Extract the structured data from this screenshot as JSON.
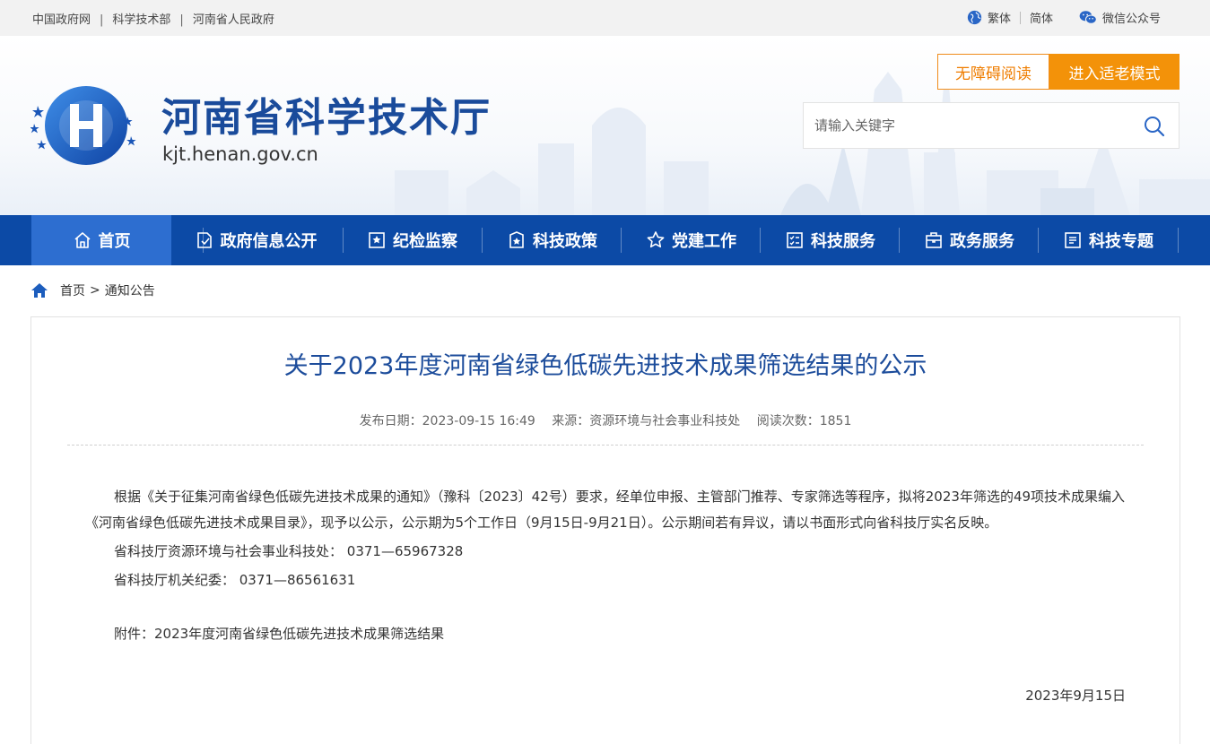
{
  "topbar": {
    "links": [
      "中国政府网",
      "科学技术部",
      "河南省人民政府"
    ],
    "separator": "|",
    "traditional": "繁体",
    "simplified": "简体",
    "wechat": "微信公众号"
  },
  "header": {
    "site_title": "河南省科学技术厅",
    "domain": "kjt.henan.gov.cn",
    "accessibility_label": "无障碍阅读",
    "elder_mode_label": "进入适老模式",
    "search_placeholder": "请输入关键字"
  },
  "nav": {
    "items": [
      {
        "label": "首页",
        "icon": "home-icon"
      },
      {
        "label": "政府信息公开",
        "icon": "document-icon"
      },
      {
        "label": "纪检监察",
        "icon": "badge-icon"
      },
      {
        "label": "科技政策",
        "icon": "book-star-icon"
      },
      {
        "label": "党建工作",
        "icon": "star-icon"
      },
      {
        "label": "科技服务",
        "icon": "checklist-icon"
      },
      {
        "label": "政务服务",
        "icon": "briefcase-icon"
      },
      {
        "label": "科技专题",
        "icon": "list-icon"
      }
    ],
    "active_index": 0
  },
  "breadcrumb": {
    "home": "首页",
    "separator": ">",
    "current": "通知公告"
  },
  "article": {
    "title": "关于2023年度河南省绿色低碳先进技术成果筛选结果的公示",
    "publish_date": "发布日期：2023-09-15 16:49",
    "source": "来源：资源环境与社会事业科技处",
    "views": "阅读次数：1851",
    "paragraph1": "根据《关于征集河南省绿色低碳先进技术成果的通知》（豫科〔2023〕42号）要求，经单位申报、主管部门推荐、专家筛选等程序，拟将2023年筛选的49项技术成果编入《河南省绿色低碳先进技术成果目录》，现予以公示，公示期为5个工作日（9月15日-9月21日）。公示期间若有异议，请以书面形式向省科技厅实名反映。",
    "contact1": "省科技厅资源环境与社会事业科技处： 0371—65967328",
    "contact2": "省科技厅机关纪委： 0371—86561631",
    "attachment": "附件：2023年度河南省绿色低碳先进技术成果筛选结果",
    "date": "2023年9月15日"
  },
  "colors": {
    "nav_bg": "#0c4aa6",
    "nav_active": "#2d6ed0",
    "title_blue": "#1a4b9b",
    "orange": "#f39209"
  }
}
